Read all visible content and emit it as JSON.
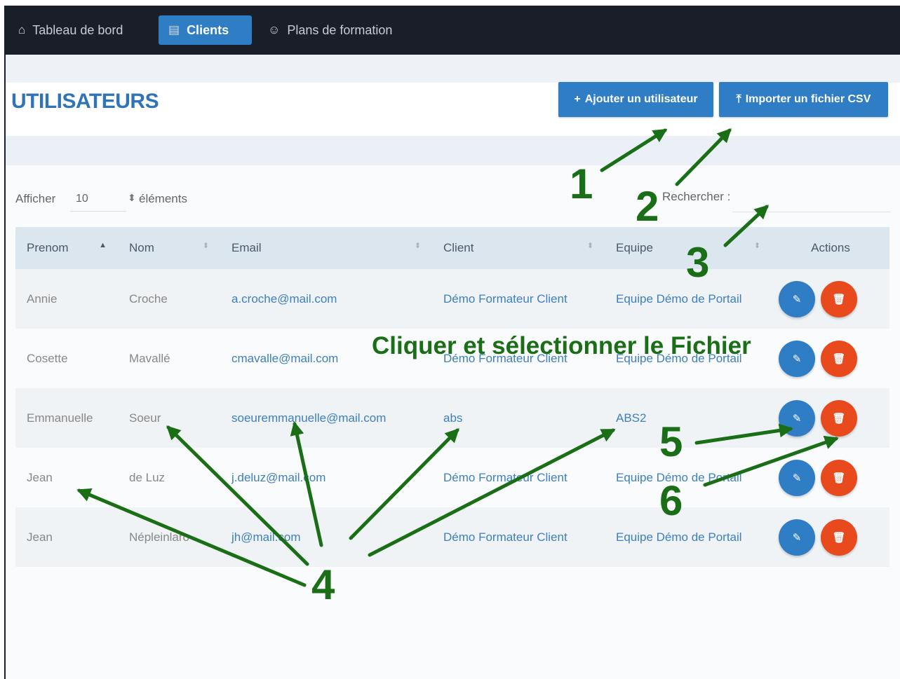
{
  "nav": {
    "items": [
      {
        "label": "Tableau de bord",
        "icon": "home-icon",
        "glyph": "⌂"
      },
      {
        "label": "Clients",
        "icon": "address-card-icon",
        "glyph": "▤"
      },
      {
        "label": "Plans de formation",
        "icon": "users-icon",
        "glyph": "☺"
      }
    ]
  },
  "header": {
    "title": "UTILISATEURS",
    "add_button": "Ajouter un utilisateur",
    "import_button": "Importer un fichier CSV"
  },
  "controls": {
    "show_label": "Afficher",
    "show_value": "10",
    "show_suffix": "éléments",
    "search_label": "Rechercher :",
    "search_value": ""
  },
  "table": {
    "columns": [
      "Prenom",
      "Nom",
      "Email",
      "Client",
      "Equipe",
      "Actions"
    ],
    "sorted_column": "Prenom",
    "sort_direction": "ascending",
    "rows": [
      {
        "prenom": "Annie",
        "nom": "Croche",
        "email": "a.croche@mail.com",
        "client": "Démo Formateur Client",
        "equipe": "Equipe Démo de Portail"
      },
      {
        "prenom": "Cosette",
        "nom": "Mavallé",
        "email": "cmavalle@mail.com",
        "client": "Démo Formateur Client",
        "equipe": "Equipe Démo de Portail"
      },
      {
        "prenom": "Emmanuelle",
        "nom": "Soeur",
        "email": "soeuremmanuelle@mail.com",
        "client": "abs",
        "equipe": "ABS2"
      },
      {
        "prenom": "Jean",
        "nom": "de Luz",
        "email": "j.deluz@mail.com",
        "client": "Démo Formateur Client",
        "equipe": "Equipe Démo de Portail"
      },
      {
        "prenom": "Jean",
        "nom": "Népleinlaro",
        "email": "jh@mail.com",
        "client": "Démo Formateur Client",
        "equipe": "Equipe Démo de Portail"
      }
    ]
  },
  "annotations": {
    "numbers": [
      "1",
      "2",
      "3",
      "4",
      "5",
      "6"
    ],
    "instruction": "Cliquer et sélectionner le Fichier",
    "color": "#1a6e16"
  },
  "colors": {
    "navbar": "#1a1e28",
    "primary": "#2f7dc4",
    "danger": "#e8491d",
    "title": "#2f73b8"
  }
}
